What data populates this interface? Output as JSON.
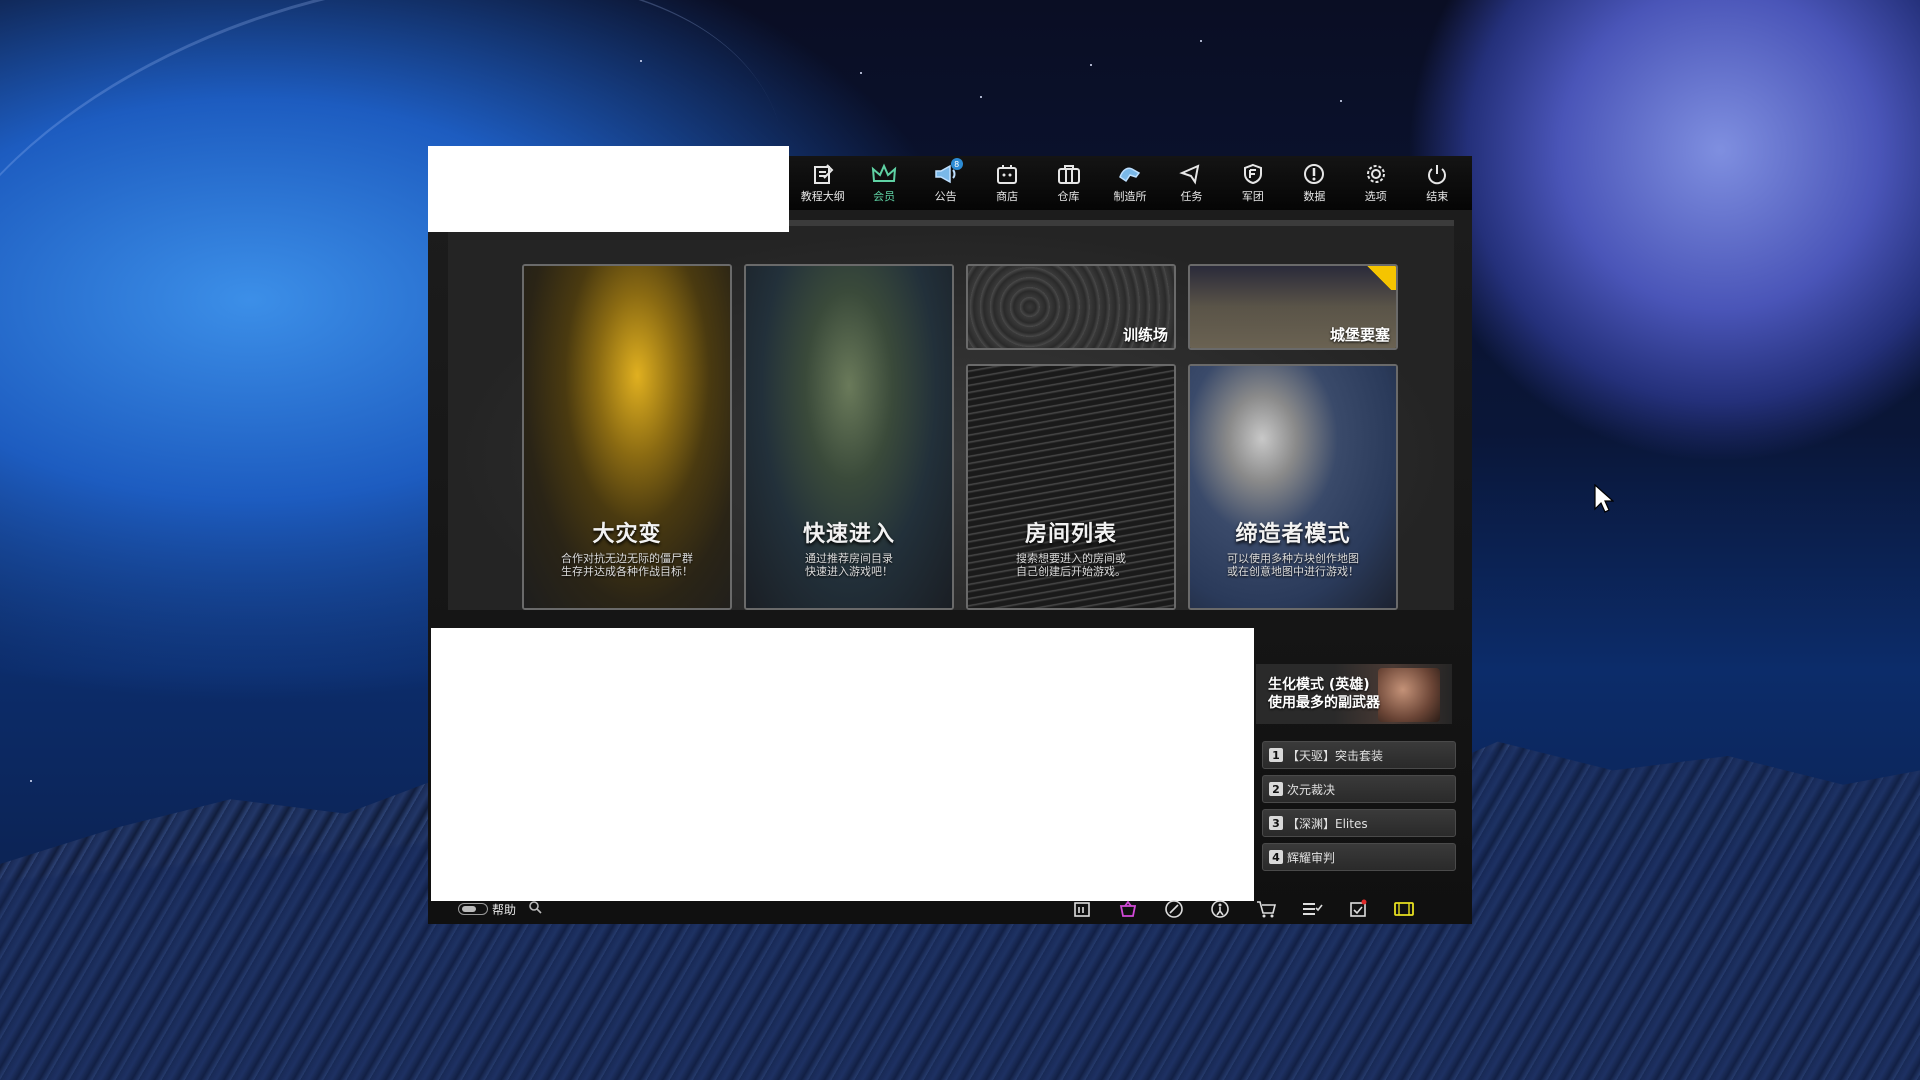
{
  "topnav": {
    "items": [
      {
        "label": "教程大纲",
        "icon": "tutorial-icon"
      },
      {
        "label": "会员",
        "icon": "crown-icon"
      },
      {
        "label": "公告",
        "icon": "megaphone-icon",
        "badge": "8"
      },
      {
        "label": "商店",
        "icon": "shop-icon"
      },
      {
        "label": "仓库",
        "icon": "inventory-icon"
      },
      {
        "label": "制造所",
        "icon": "crafting-icon"
      },
      {
        "label": "任务",
        "icon": "mission-icon"
      },
      {
        "label": "军团",
        "icon": "clan-icon"
      },
      {
        "label": "数据",
        "icon": "data-icon"
      },
      {
        "label": "选项",
        "icon": "gear-icon"
      },
      {
        "label": "结束",
        "icon": "power-icon"
      }
    ],
    "active_index": 1,
    "active_color": "#5fd2a4"
  },
  "modes": {
    "zombie": {
      "title": "大灾变",
      "desc": "合作对抗无边无际的僵尸群\n生存并达成各种作战目标！"
    },
    "quick": {
      "title": "快速进入",
      "desc": "通过推荐房间目录\n快速进入游戏吧！"
    },
    "room_list": {
      "title": "房间列表",
      "desc": "搜索想要进入的房间或\n自己创建后开始游戏。"
    },
    "creator": {
      "title": "缔造者模式",
      "desc": "可以使用多种方块创作地图\n或在创意地图中进行游戏！"
    },
    "training": {
      "label": "训练场"
    },
    "castle": {
      "label": "城堡要塞"
    }
  },
  "side_panel": {
    "banner_line1": "生化模式 (英雄)",
    "banner_line2": "使用最多的副武器",
    "weapons": [
      {
        "rank": "1",
        "name": "【天驱】突击套装"
      },
      {
        "rank": "2",
        "name": "次元裁决"
      },
      {
        "rank": "3",
        "name": "【深渊】Elites"
      },
      {
        "rank": "4",
        "name": "辉耀审判"
      }
    ]
  },
  "bottom": {
    "help_label": "帮助",
    "icons": [
      "calendar-icon",
      "basket-icon",
      "compass-icon",
      "accessibility-icon",
      "cart-icon",
      "list-icon",
      "checklist-icon",
      "ticket-icon"
    ]
  }
}
